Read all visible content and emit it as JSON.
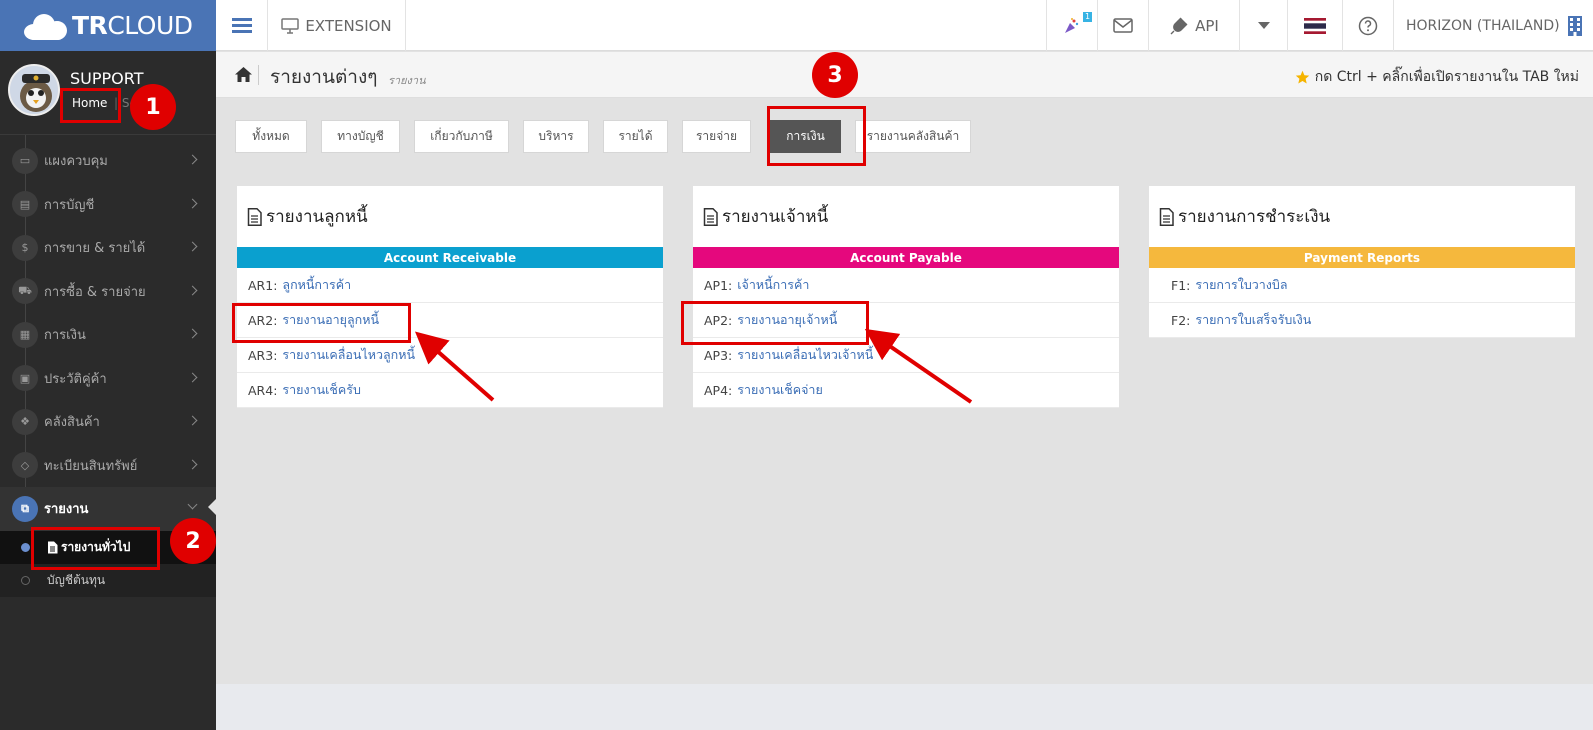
{
  "brand": {
    "bold": "TR",
    "light": "CLOUD"
  },
  "topbar": {
    "extension_label": "EXTENSION",
    "notification_count": "1",
    "api_label": "API",
    "company": "HORIZON (THAILAND)"
  },
  "profile": {
    "name": "SUPPORT",
    "home_link": "Home",
    "second_link_partial": "Se"
  },
  "sidebar": {
    "items": [
      {
        "label": "แผงควบคุม",
        "icon": "monitor-icon"
      },
      {
        "label": "การบัญชี",
        "icon": "book-icon"
      },
      {
        "label": "การขาย & รายได้",
        "icon": "dollar-icon"
      },
      {
        "label": "การซื้อ & รายจ่าย",
        "icon": "cart-icon"
      },
      {
        "label": "การเงิน",
        "icon": "calendar-icon"
      },
      {
        "label": "ประวัติคู่ค้า",
        "icon": "contact-icon"
      },
      {
        "label": "คลังสินค้า",
        "icon": "cubes-icon"
      },
      {
        "label": "ทะเบียนสินทรัพย์",
        "icon": "diamond-icon"
      }
    ],
    "active": {
      "label": "รายงาน",
      "icon": "reports-icon"
    },
    "sub_items": [
      {
        "label": "รายงานทั่วไป",
        "icon": "document-icon"
      },
      {
        "label": "บัญชีต้นทุน"
      }
    ]
  },
  "header": {
    "title": "รายงานต่างๆ",
    "subtitle": "รายงาน",
    "hint": "กด Ctrl + คลิ๊กเพื่อเปิดรายงานใน TAB ใหม่"
  },
  "tabs": [
    {
      "label": "ทั้งหมด"
    },
    {
      "label": "ทางบัญชี"
    },
    {
      "label": "เกี่ยวกับภาษี"
    },
    {
      "label": "บริหาร"
    },
    {
      "label": "รายได้"
    },
    {
      "label": "รายจ่าย"
    },
    {
      "label": "การเงิน"
    },
    {
      "label": "รายงานคลังสินค้า"
    }
  ],
  "active_tab": "การเงิน",
  "panels": {
    "ar": {
      "title": "รายงานลูกหนี้",
      "bar": "Account Receivable",
      "bar_color": "#0aa0cf",
      "rows": [
        {
          "code": "AR1:",
          "label": "ลูกหนี้การค้า"
        },
        {
          "code": "AR2:",
          "label": "รายงานอายุลูกหนี้"
        },
        {
          "code": "AR3:",
          "label": "รายงานเคลื่อนไหวลูกหนี้"
        },
        {
          "code": "AR4:",
          "label": "รายงานเช็ครับ"
        }
      ]
    },
    "ap": {
      "title": "รายงานเจ้าหนี้",
      "bar": "Account Payable",
      "bar_color": "#e5087d",
      "rows": [
        {
          "code": "AP1:",
          "label": "เจ้าหนี้การค้า"
        },
        {
          "code": "AP2:",
          "label": "รายงานอายุเจ้าหนี้"
        },
        {
          "code": "AP3:",
          "label": "รายงานเคลื่อนไหวเจ้าหนี้"
        },
        {
          "code": "AP4:",
          "label": "รายงานเช็คจ่าย"
        }
      ]
    },
    "pay": {
      "title": "รายงานการชำระเงิน",
      "bar": "Payment Reports",
      "bar_color": "#f5b83d",
      "rows": [
        {
          "code": "F1:",
          "label": "รายการใบวางบิล"
        },
        {
          "code": "F2:",
          "label": "รายการใบเสร็จรับเงิน"
        }
      ]
    }
  },
  "annotations": [
    "1",
    "2",
    "3"
  ],
  "colors": {
    "accent": "#4a74b5",
    "annotation": "#e00000",
    "sidebar_bg": "#2b2b2b"
  }
}
